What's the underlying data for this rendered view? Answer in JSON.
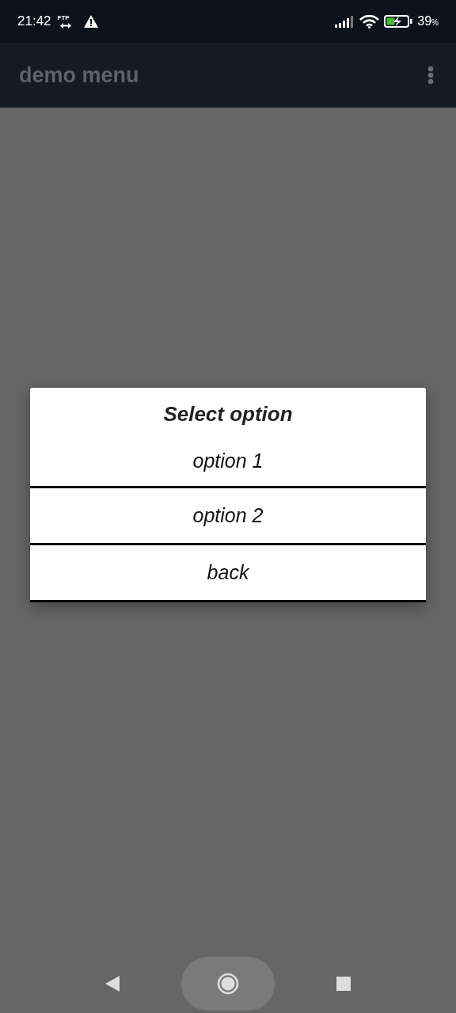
{
  "status_bar": {
    "time": "21:42",
    "ftp_label": "FTP",
    "battery": "39",
    "battery_unit": "%"
  },
  "app_bar": {
    "title": "demo menu"
  },
  "dialog": {
    "title": "Select option",
    "options": [
      {
        "label": "option 1"
      },
      {
        "label": "option 2"
      },
      {
        "label": "back"
      }
    ]
  }
}
